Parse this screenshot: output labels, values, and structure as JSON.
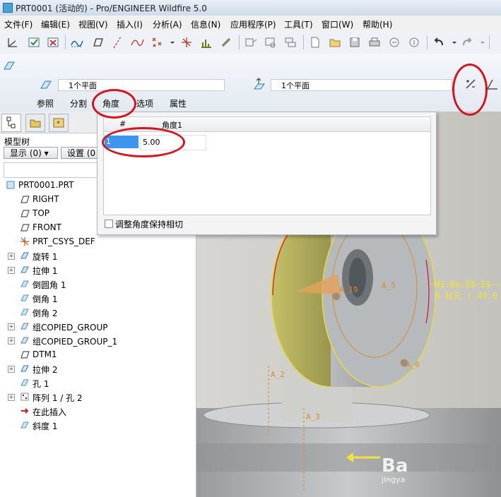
{
  "window": {
    "title": "PRT0001 (活动的) - Pro/ENGINEER Wildfire 5.0"
  },
  "menu": [
    "文件(F)",
    "编辑(E)",
    "视图(V)",
    "插入(I)",
    "分析(A)",
    "信息(N)",
    "应用程序(P)",
    "工具(T)",
    "窗口(W)",
    "帮助(H)"
  ],
  "dashboard": {
    "ref1": "1个平面",
    "ref2": "1个平面",
    "tabs": [
      "参照",
      "分割",
      "角度",
      "选项",
      "属性"
    ],
    "active_tab": "角度"
  },
  "angle_panel": {
    "col_num": "#",
    "col_angle": "角度1",
    "row_num": "1",
    "row_value": "5.00",
    "checkbox_label": "调整角度保持相切"
  },
  "model_tree": {
    "title": "模型树",
    "show_btn": "显示 (0) ▾",
    "settings_btn": "设置 (0",
    "items": [
      {
        "label": "PRT0001.PRT",
        "icon": "part-icon"
      },
      {
        "label": "RIGHT",
        "icon": "datum-plane-icon"
      },
      {
        "label": "TOP",
        "icon": "datum-plane-icon"
      },
      {
        "label": "FRONT",
        "icon": "datum-plane-icon"
      },
      {
        "label": "PRT_CSYS_DEF",
        "icon": "csys-icon"
      },
      {
        "label": "旋转 1",
        "icon": "revolve-icon"
      },
      {
        "label": "拉伸 1",
        "icon": "extrude-icon"
      },
      {
        "label": "倒圆角 1",
        "icon": "round-icon"
      },
      {
        "label": "倒角 1",
        "icon": "chamfer-icon"
      },
      {
        "label": "倒角 2",
        "icon": "chamfer-icon"
      },
      {
        "label": "组COPIED_GROUP",
        "icon": "group-icon"
      },
      {
        "label": "组COPIED_GROUP_1",
        "icon": "group-icon"
      },
      {
        "label": "DTM1",
        "icon": "datum-plane-icon"
      },
      {
        "label": "拉伸 2",
        "icon": "extrude-icon"
      },
      {
        "label": "孔 1",
        "icon": "hole-icon"
      },
      {
        "label": "阵列 1 / 孔 2",
        "icon": "pattern-icon"
      },
      {
        "label": "在此插入",
        "icon": "insert-arrow-icon"
      },
      {
        "label": "斜度 1",
        "icon": "draft-icon"
      }
    ]
  },
  "viewport": {
    "dims": [
      "A_19",
      "A_5",
      "A_6",
      "A_2",
      "A_3"
    ],
    "note_line1": "M1.8x.35 IS",
    "note_line2": "0 钻孔 ( 40.0"
  },
  "watermark": {
    "text1": "Ba",
    "text2": "jingya"
  },
  "colors": {
    "annotation_red": "#d4141e",
    "selection_blue": "#3d95f0",
    "dim_orange": "#d98a2b"
  }
}
